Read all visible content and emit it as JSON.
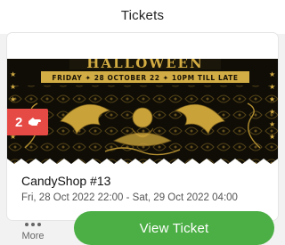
{
  "header": {
    "title": "Tickets"
  },
  "ticket": {
    "image_banner_title": "HALLOWEEN",
    "image_banner_line": "FRIDAY ✦ 28 OCTOBER 22 ✦ 10PM TILL LATE",
    "badge_count": "2",
    "name": "CandyShop #13",
    "dates": "Fri, 28 Oct 2022 22:00 - Sat, 29 Oct 2022 04:00"
  },
  "actions": {
    "more_label": "More",
    "view_ticket_label": "View Ticket"
  },
  "colors": {
    "accent_green": "#4caf45",
    "badge_red": "#e64a45",
    "gold": "#c9a23a",
    "poster_black": "#0f0d06"
  },
  "icons": {
    "badge_icon": "hand-icon",
    "more_icon": "more-dots-icon"
  }
}
